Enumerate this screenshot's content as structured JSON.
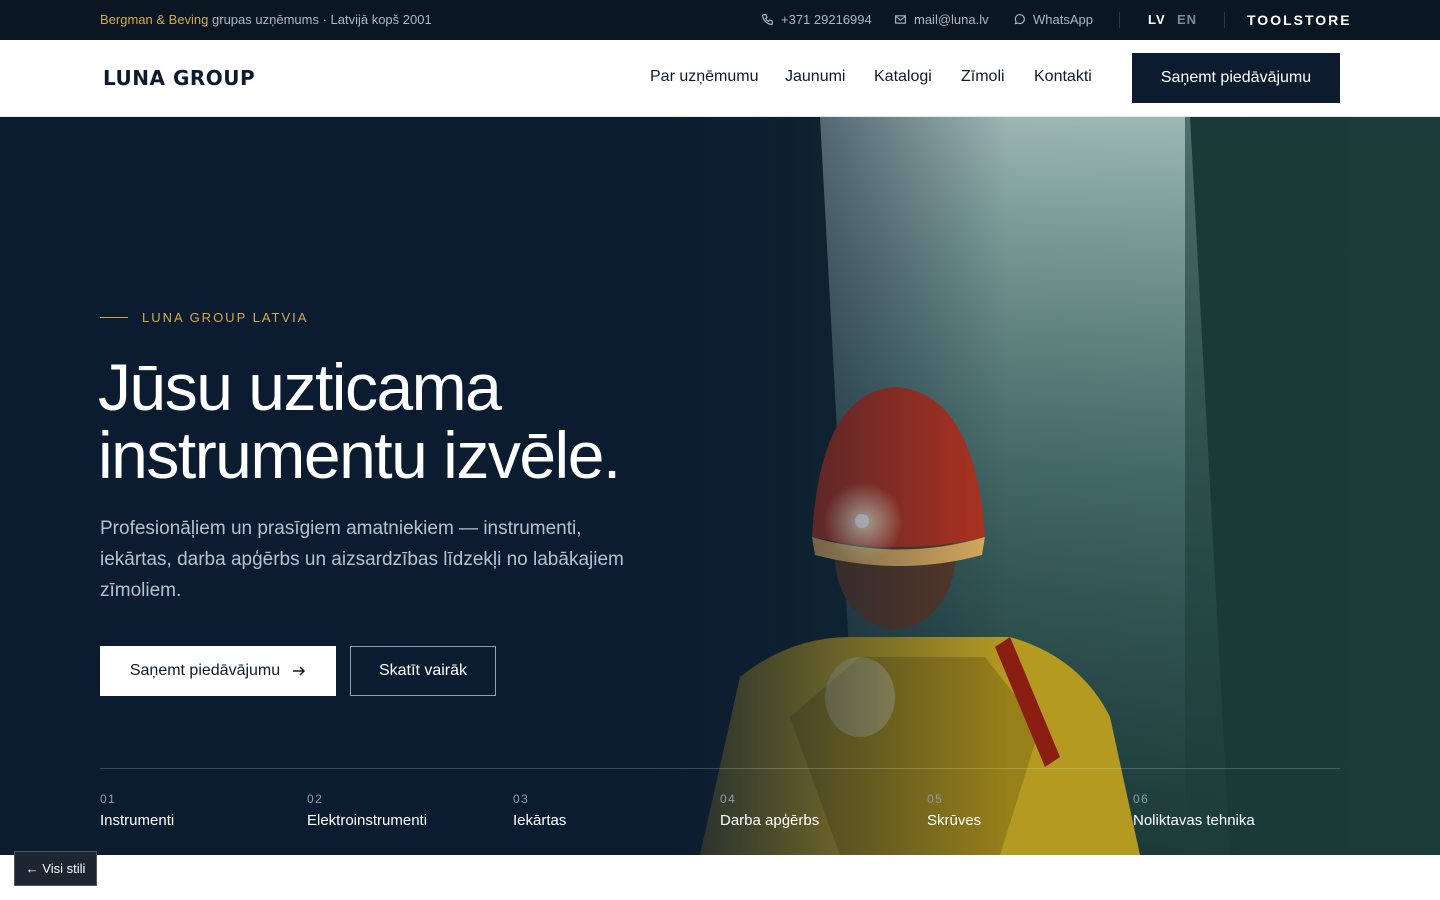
{
  "topbar": {
    "brand": "Bergman & Beving",
    "tagline": " grupas uzņēmums · Latvijā kopš 2001",
    "phone": "+371 29216994",
    "email": "mail@luna.lv",
    "whatsapp": "WhatsApp",
    "lang_lv": "LV",
    "lang_en": "EN",
    "toolstore": "TOOLSTORE",
    "phone_icon": "phone-icon",
    "email_icon": "mail-icon",
    "whatsapp_icon": "whatsapp-icon"
  },
  "header": {
    "logo": "LUNA GROUP",
    "nav": [
      "Par uzņēmumu",
      "Jaunumi",
      "Katalogi",
      "Zīmoli",
      "Kontakti"
    ],
    "cta": "Saņemt piedāvājumu"
  },
  "hero": {
    "eyebrow": "LUNA GROUP LATVIA",
    "title_line1": "Jūsu uzticama",
    "title_line2": "instrumentu izvēle.",
    "lead": "Profesionāļiem un prasīgiem amatniekiem — instrumenti, iekārtas, darba apģērbs un aizsardzības līdzekļi no labākajiem zīmoliem.",
    "btn_primary": "Saņemt piedāvājumu",
    "btn_primary_icon": "arrow-right-icon",
    "btn_secondary": "Skatīt vairāk",
    "categories": [
      {
        "num": "01",
        "name": "Instrumenti"
      },
      {
        "num": "02",
        "name": "Elektroinstrumenti"
      },
      {
        "num": "03",
        "name": "Iekārtas"
      },
      {
        "num": "04",
        "name": "Darba apģērbs"
      },
      {
        "num": "05",
        "name": "Skrūves"
      },
      {
        "num": "06",
        "name": "Noliktavas tehnika"
      }
    ]
  },
  "footer_ui": {
    "back": "← Visi stili"
  },
  "colors": {
    "accent_gold": "#d3a84c",
    "navy": "#0d1b2e"
  }
}
